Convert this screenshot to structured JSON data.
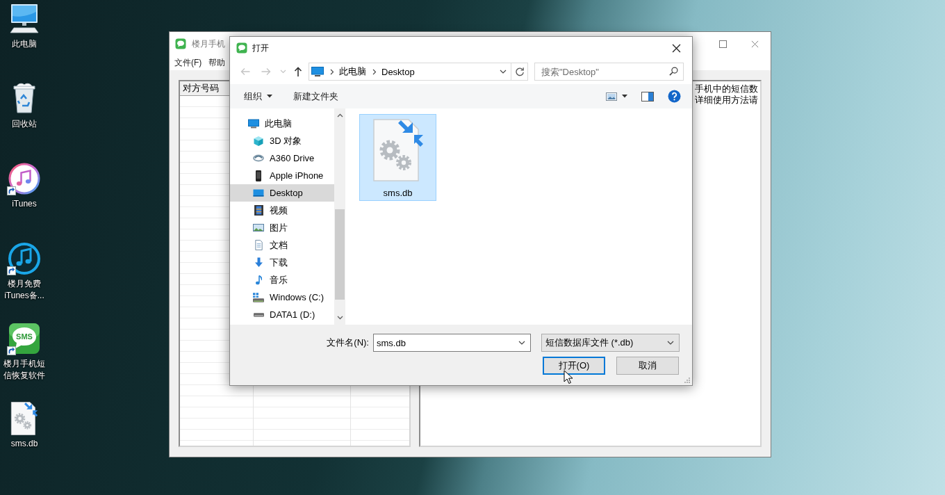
{
  "desktop": {
    "icons": [
      {
        "label": "此电脑",
        "kind": "computer",
        "shortcut": false
      },
      {
        "label": "回收站",
        "kind": "recyclebin",
        "shortcut": false
      },
      {
        "label": "iTunes",
        "kind": "itunes",
        "shortcut": true
      },
      {
        "label": "楼月免费iTunes备...",
        "kind": "backup",
        "shortcut": true
      },
      {
        "label": "楼月手机短信恢复软件",
        "kind": "sms",
        "shortcut": true,
        "icon_text": "SMS"
      },
      {
        "label": "sms.db",
        "kind": "dbfile",
        "shortcut": false
      }
    ]
  },
  "app_window": {
    "title": "楼月手机",
    "menu": [
      "文件(F)",
      "帮助"
    ],
    "table": {
      "columns": [
        "对方号码"
      ]
    },
    "info_lines": [
      "手机中的短信数",
      "详细使用方法请"
    ]
  },
  "open_dialog": {
    "title": "打开",
    "nav_buttons": [
      {
        "kind": "back",
        "disabled": true
      },
      {
        "kind": "forward",
        "disabled": true
      },
      {
        "kind": "recent",
        "disabled": true
      },
      {
        "kind": "up",
        "disabled": false
      }
    ],
    "address": [
      "此电脑",
      "Desktop"
    ],
    "search": {
      "placeholder": "搜索\"Desktop\""
    },
    "toolbar": {
      "organize": "组织",
      "new_folder": "新建文件夹"
    },
    "nav": {
      "items": [
        {
          "label": "此电脑",
          "kind": "computer",
          "selected": false,
          "children": [
            {
              "label": "3D 对象",
              "kind": "objects3d",
              "selected": false
            },
            {
              "label": "A360 Drive",
              "kind": "cloud",
              "selected": false
            },
            {
              "label": "Apple iPhone",
              "kind": "phone",
              "selected": false
            },
            {
              "label": "Desktop",
              "kind": "desktop",
              "selected": true
            },
            {
              "label": "视频",
              "kind": "videos",
              "selected": false
            },
            {
              "label": "图片",
              "kind": "pictures",
              "selected": false
            },
            {
              "label": "文档",
              "kind": "documents",
              "selected": false
            },
            {
              "label": "下载",
              "kind": "downloads",
              "selected": false
            },
            {
              "label": "音乐",
              "kind": "music",
              "selected": false
            },
            {
              "label": "Windows (C:)",
              "kind": "systemdrive",
              "selected": false
            },
            {
              "label": "DATA1 (D:)",
              "kind": "drive",
              "selected": false
            }
          ]
        }
      ]
    },
    "files": [
      {
        "name": "sms.db",
        "selected": true
      }
    ],
    "filename": {
      "label": "文件名(N):",
      "value": "sms.db"
    },
    "file_type": {
      "value": "短信数据库文件 (*.db)"
    },
    "buttons": [
      {
        "label": "打开(O)",
        "focused": true
      },
      {
        "label": "取消",
        "focused": false
      }
    ]
  }
}
